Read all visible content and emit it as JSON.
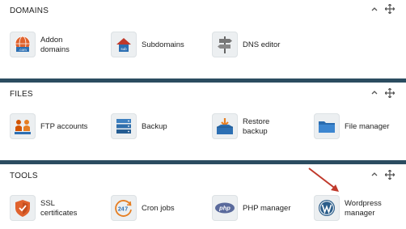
{
  "sections": [
    {
      "title": "DOMAINS",
      "items": [
        {
          "label": "Addon\ndomains",
          "icon": "globe-icon"
        },
        {
          "label": "Subdomains",
          "icon": "house-sub-icon"
        },
        {
          "label": "DNS editor",
          "icon": "signpost-icon"
        }
      ]
    },
    {
      "title": "FILES",
      "items": [
        {
          "label": "FTP accounts",
          "icon": "ftp-users-icon"
        },
        {
          "label": "Backup",
          "icon": "server-icon"
        },
        {
          "label": "Restore\nbackup",
          "icon": "restore-box-icon"
        },
        {
          "label": "File manager",
          "icon": "folder-icon"
        }
      ]
    },
    {
      "title": "TOOLS",
      "items": [
        {
          "label": "SSL\ncertificates",
          "icon": "shield-icon"
        },
        {
          "label": "Cron jobs",
          "icon": "clock-24-7-icon",
          "badge": "24 7"
        },
        {
          "label": "PHP manager",
          "icon": "php-icon",
          "badge": "php"
        },
        {
          "label": "Wordpress\nmanager",
          "icon": "wordpress-icon"
        }
      ]
    }
  ],
  "colors": {
    "section_border": "#2b4c60",
    "icon_bg": "#eceff1",
    "annotation_arrow": "#c0392b"
  }
}
